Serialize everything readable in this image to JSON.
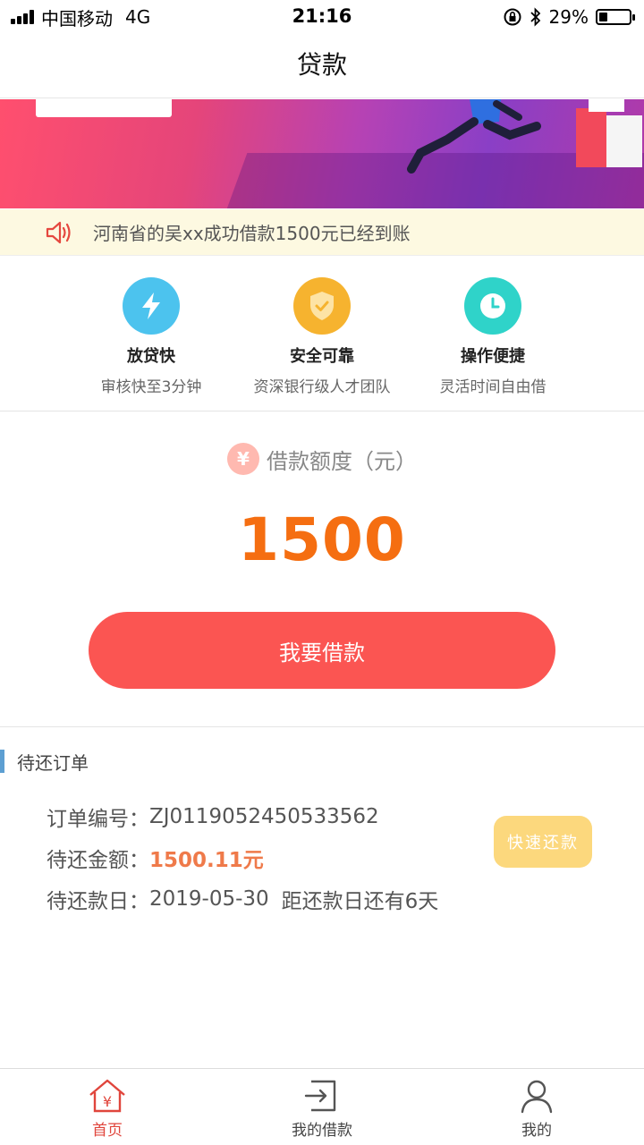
{
  "status_bar": {
    "carrier": "中国移动",
    "network": "4G",
    "time": "21:16",
    "battery_percent": "29%",
    "battery_level": 0.29,
    "icons": [
      "signal-icon",
      "orientation-lock-icon",
      "bluetooth-icon",
      "battery-icon"
    ]
  },
  "nav": {
    "title": "贷款"
  },
  "banner": {
    "page_count": 1,
    "active_page": 0
  },
  "notice": {
    "icon": "speaker-icon",
    "text": "河南省的吴xx成功借款1500元已经到账"
  },
  "features": [
    {
      "icon": "lightning-icon",
      "color": "#4cc3ee",
      "title": "放贷快",
      "desc": "审核快至3分钟"
    },
    {
      "icon": "shield-check-icon",
      "color": "#f6b32f",
      "title": "安全可靠",
      "desc": "资深银行级人才团队"
    },
    {
      "icon": "clock-icon",
      "color": "#2fd3c9",
      "title": "操作便捷",
      "desc": "灵活时间自由借"
    }
  ],
  "loan": {
    "currency_icon": "yen-icon",
    "currency_symbol": "¥",
    "quota_label": "借款额度（元）",
    "amount": "1500",
    "borrow_button": "我要借款"
  },
  "pending": {
    "title": "待还订单",
    "order_no_label": "订单编号：",
    "order_no": "ZJ0119052450533562",
    "amount_label": "待还金额：",
    "amount": "1500.11元",
    "due_label": "待还款日：",
    "due_date": "2019-05-30",
    "due_remaining": "距还款日还有6天",
    "quick_repay_button": "快速还款"
  },
  "tab_bar": [
    {
      "icon": "home-icon",
      "label": "首页",
      "active": true
    },
    {
      "icon": "my-loans-icon",
      "label": "我的借款",
      "active": false
    },
    {
      "icon": "user-icon",
      "label": "我的",
      "active": false
    }
  ],
  "colors": {
    "accent_red": "#fb5552",
    "amount_orange": "#f56e11",
    "quick_button": "#fcd87d",
    "notice_bg": "#fdf9e1",
    "tab_active": "#e0453c"
  }
}
